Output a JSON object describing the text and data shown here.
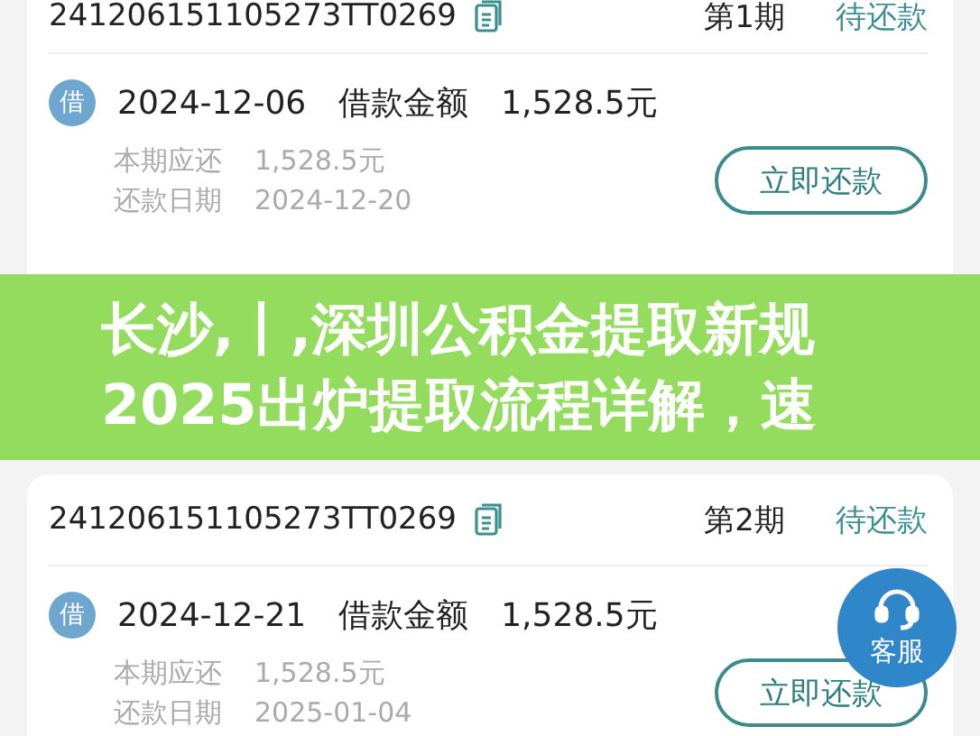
{
  "loans": [
    {
      "order_no": "241206151105273TT0269",
      "period": "第1期",
      "status": "待还款",
      "entries": [
        {
          "badge": "借",
          "color": "#6fa6cf",
          "date": "2024-12-06",
          "label": "借款金额",
          "amount": "1,528.5元",
          "details": [
            {
              "label": "本期应还",
              "value": "1,528.5元"
            },
            {
              "label": "还款日期",
              "value": "2024-12-20"
            }
          ],
          "action": "立即还款"
        }
      ]
    },
    {
      "order_no": "241206151105273TT0269",
      "period": "第2期",
      "status": "待还款",
      "entries": [
        {
          "badge": "借",
          "color": "#6fa6cf",
          "date": "2024-12-21",
          "label": "借款金额",
          "amount": "1,528.5元",
          "details": [
            {
              "label": "本期应还",
              "value": "1,528.5元"
            },
            {
              "label": "还款日期",
              "value": "2025-01-04"
            }
          ],
          "action": "立即还款"
        }
      ]
    }
  ],
  "support_button": {
    "label": "客服"
  },
  "banner": {
    "lines": [
      "长沙,丨,深圳公积金提取新规",
      "2025出炉提取流程详解，速"
    ]
  }
}
